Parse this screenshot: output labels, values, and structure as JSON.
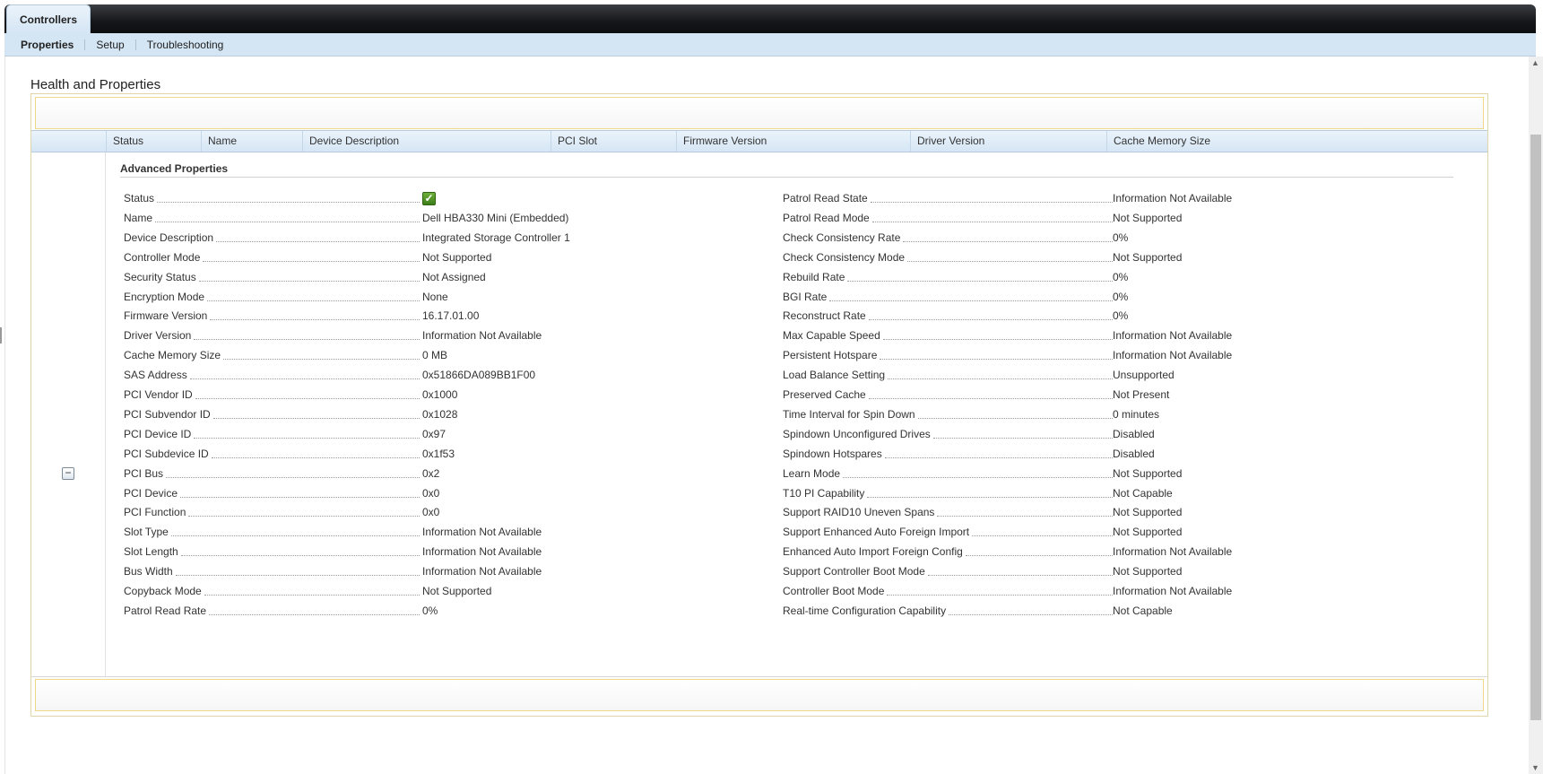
{
  "tabs": {
    "main": "Controllers"
  },
  "subnav": [
    "Properties",
    "Setup",
    "Troubleshooting"
  ],
  "page_title": "Health and Properties",
  "columns": [
    "Status",
    "Name",
    "Device Description",
    "PCI Slot",
    "Firmware Version",
    "Driver Version",
    "Cache Memory Size"
  ],
  "advanced": {
    "title": "Advanced Properties",
    "left": [
      {
        "label": "Status",
        "value": ""
      },
      {
        "label": "Name",
        "value": "Dell HBA330 Mini (Embedded)"
      },
      {
        "label": "Device Description",
        "value": "Integrated Storage Controller 1"
      },
      {
        "label": "Controller Mode",
        "value": "Not Supported"
      },
      {
        "label": "Security Status",
        "value": "Not Assigned"
      },
      {
        "label": "Encryption Mode",
        "value": "None"
      },
      {
        "label": "Firmware Version",
        "value": "16.17.01.00"
      },
      {
        "label": "Driver Version",
        "value": "Information Not Available"
      },
      {
        "label": "Cache Memory Size",
        "value": "0 MB"
      },
      {
        "label": "SAS Address",
        "value": "0x51866DA089BB1F00"
      },
      {
        "label": "PCI Vendor ID",
        "value": "0x1000"
      },
      {
        "label": "PCI Subvendor ID",
        "value": "0x1028"
      },
      {
        "label": "PCI Device ID",
        "value": "0x97"
      },
      {
        "label": "PCI Subdevice ID",
        "value": "0x1f53"
      },
      {
        "label": "PCI Bus",
        "value": "0x2"
      },
      {
        "label": "PCI Device",
        "value": "0x0"
      },
      {
        "label": "PCI Function",
        "value": "0x0"
      },
      {
        "label": "Slot Type",
        "value": "Information Not Available"
      },
      {
        "label": "Slot Length",
        "value": "Information Not Available"
      },
      {
        "label": "Bus Width",
        "value": "Information Not Available"
      },
      {
        "label": "Copyback Mode",
        "value": "Not Supported"
      },
      {
        "label": "Patrol Read Rate",
        "value": "0%"
      }
    ],
    "right": [
      {
        "label": "Patrol Read State",
        "value": "Information Not Available"
      },
      {
        "label": "Patrol Read Mode",
        "value": "Not Supported"
      },
      {
        "label": "Check Consistency Rate",
        "value": "0%"
      },
      {
        "label": "Check Consistency Mode",
        "value": "Not Supported"
      },
      {
        "label": "Rebuild Rate",
        "value": "0%"
      },
      {
        "label": "BGI Rate",
        "value": "0%"
      },
      {
        "label": "Reconstruct Rate",
        "value": "0%"
      },
      {
        "label": "Max Capable Speed",
        "value": "Information Not Available"
      },
      {
        "label": "Persistent Hotspare",
        "value": "Information Not Available"
      },
      {
        "label": "Load Balance Setting",
        "value": "Unsupported"
      },
      {
        "label": "Preserved Cache",
        "value": "Not Present"
      },
      {
        "label": "Time Interval for Spin Down",
        "value": "0 minutes"
      },
      {
        "label": "Spindown Unconfigured Drives",
        "value": "Disabled"
      },
      {
        "label": "Spindown Hotspares",
        "value": "Disabled"
      },
      {
        "label": "Learn Mode",
        "value": "Not Supported"
      },
      {
        "label": "T10 PI Capability",
        "value": "Not Capable"
      },
      {
        "label": "Support RAID10 Uneven Spans",
        "value": "Not Supported"
      },
      {
        "label": "Support Enhanced Auto Foreign Import",
        "value": "Not Supported"
      },
      {
        "label": "Enhanced Auto Import Foreign Config",
        "value": "Information Not Available"
      },
      {
        "label": "Support Controller Boot Mode",
        "value": "Not Supported"
      },
      {
        "label": "Controller Boot Mode",
        "value": "Information Not Available"
      },
      {
        "label": "Real-time Configuration Capability",
        "value": "Not Capable"
      }
    ]
  },
  "icons": {
    "status": "check-ok-icon",
    "collapse": "collapse-minus-icon",
    "scroll_up": "scroll-up-arrow-icon",
    "scroll_down": "scroll-down-arrow-icon"
  },
  "colors": {
    "accent": "#d4e5f4",
    "status_ok": "#4a8a22",
    "tabbar": "#15171a"
  }
}
